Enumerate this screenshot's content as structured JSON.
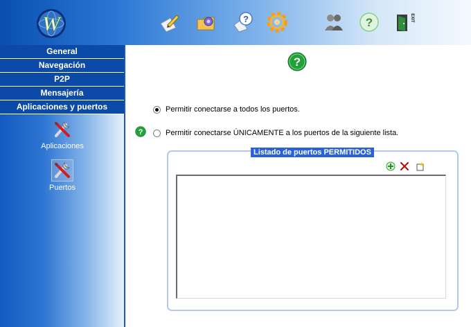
{
  "window": {
    "brand_logo": "W"
  },
  "toolbar": {
    "icons": [
      "edit-icon",
      "settings-folder-icon",
      "help-bubble-icon",
      "gear-icon",
      "users-icon",
      "help-icon",
      "exit-door-icon"
    ],
    "exit_label": "EXIT"
  },
  "sidebar": {
    "menu": [
      {
        "label": "General"
      },
      {
        "label": "Navegación"
      },
      {
        "label": "P2P"
      },
      {
        "label": "Mensajería"
      },
      {
        "label": "Aplicaciones y puertos"
      }
    ],
    "tools": [
      {
        "label": "Aplicaciones",
        "icon": "tools-icon"
      },
      {
        "label": "Puertos",
        "icon": "tools-icon",
        "selected": true
      }
    ]
  },
  "main": {
    "radio_all": {
      "label": "Permitir conectarse a todos los puertos.",
      "checked": true
    },
    "radio_only": {
      "label": "Permitir conectarse ÚNICAMENTE a los puertos de la siguiente lista.",
      "checked": false
    },
    "ports_group": {
      "title": "Listado de puertos PERMITIDOS",
      "actions": [
        "add-icon",
        "delete-icon",
        "new-icon"
      ],
      "items": []
    }
  },
  "colors": {
    "menu_bg": "#0c4aa8",
    "help_green": "#22a03a",
    "legend_bg": "#2a63d8",
    "group_border": "#b3c8ef"
  }
}
